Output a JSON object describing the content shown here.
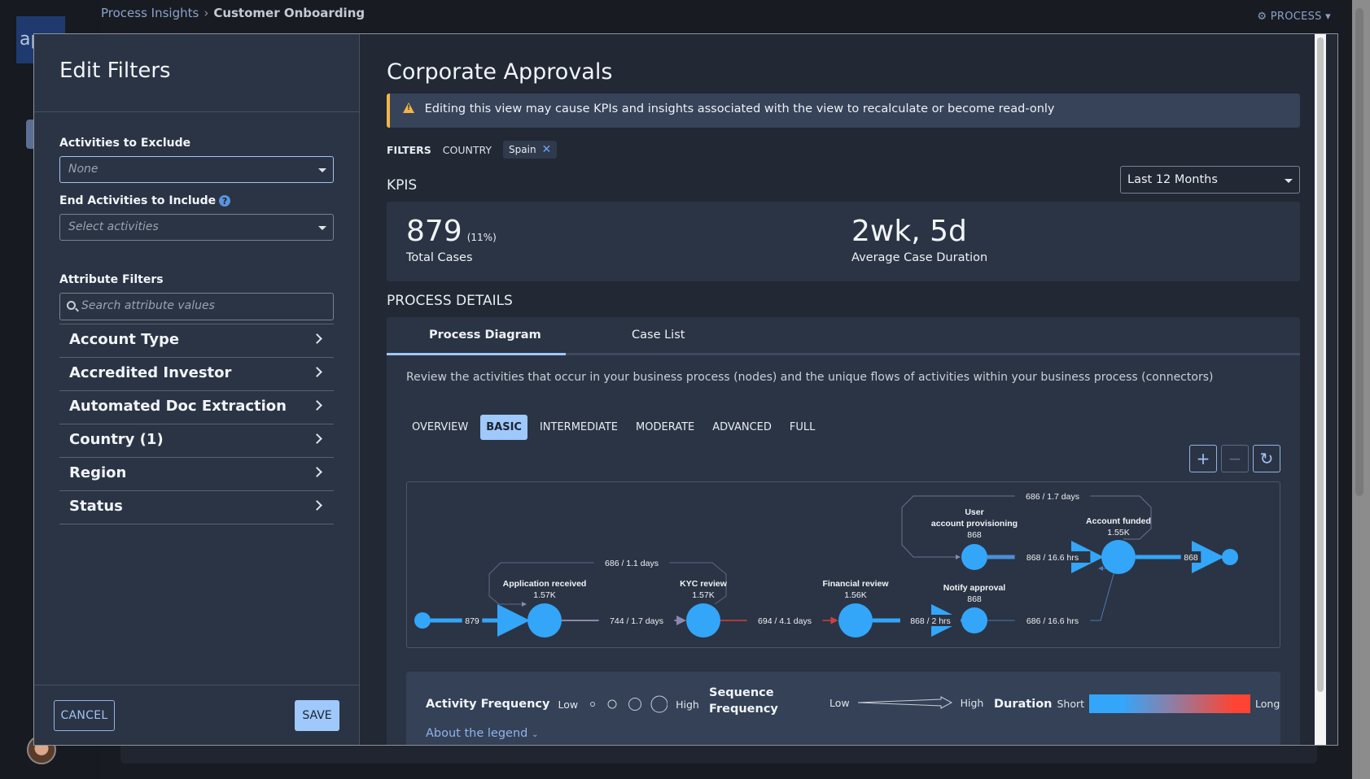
{
  "app": {
    "logo_text": "ap",
    "breadcrumb": {
      "parent": "Process Insights",
      "separator": "›",
      "current": "Customer Onboarding"
    },
    "process_menu": {
      "label": "PROCESS",
      "icon": "gear-icon"
    }
  },
  "filters_panel": {
    "title": "Edit Filters",
    "activities_to_exclude": {
      "label": "Activities to Exclude",
      "value": "None"
    },
    "end_activities": {
      "label": "End Activities to Include",
      "placeholder": "Select activities",
      "help_icon": "question-circle-icon"
    },
    "attribute_filters": {
      "label": "Attribute Filters",
      "search_placeholder": "Search attribute values",
      "items": [
        {
          "label": "Account Type"
        },
        {
          "label": "Accredited Investor"
        },
        {
          "label": "Automated Doc Extraction"
        },
        {
          "label": "Country (1)"
        },
        {
          "label": "Region"
        },
        {
          "label": "Status"
        }
      ]
    },
    "cancel_label": "CANCEL",
    "save_label": "SAVE"
  },
  "view": {
    "title": "Corporate Approvals",
    "warning": "Editing this view may cause KPIs and insights associated with the view to recalculate or become read-only",
    "filters": {
      "label": "FILTERS",
      "key": "COUNTRY",
      "chip": "Spain"
    },
    "kpis_title": "KPIS",
    "period": "Last 12 Months",
    "kpis": [
      {
        "value": "879",
        "pct": "(11%)",
        "caption": "Total Cases"
      },
      {
        "value": "2wk, 5d",
        "caption": "Average Case Duration"
      }
    ],
    "process_details_title": "PROCESS DETAILS",
    "tabs": [
      {
        "label": "Process Diagram",
        "active": true
      },
      {
        "label": "Case List",
        "active": false
      }
    ],
    "description": "Review the activities that occur in your business process (nodes) and the unique flows of activities within your business process (connectors)",
    "levels": [
      {
        "label": "OVERVIEW",
        "active": false
      },
      {
        "label": "BASIC",
        "active": true
      },
      {
        "label": "INTERMEDIATE",
        "active": false
      },
      {
        "label": "MODERATE",
        "active": false
      },
      {
        "label": "ADVANCED",
        "active": false
      },
      {
        "label": "FULL",
        "active": false
      }
    ],
    "zoom": {
      "in": "+",
      "out": "−",
      "reset": "↻"
    }
  },
  "diagram": {
    "nodes": [
      {
        "id": "start",
        "label": "",
        "count": ""
      },
      {
        "id": "app",
        "label": "Application received",
        "count": "1.57K"
      },
      {
        "id": "kyc",
        "label": "KYC review",
        "count": "1.57K"
      },
      {
        "id": "fin",
        "label": "Financial review",
        "count": "1.56K"
      },
      {
        "id": "notify",
        "label": "Notify approval",
        "count": "868"
      },
      {
        "id": "user",
        "label": "User account provisioning",
        "label_lines": [
          "User",
          "account provisioning"
        ],
        "count": "868"
      },
      {
        "id": "funded",
        "label": "Account funded",
        "count": "1.55K"
      },
      {
        "id": "end",
        "label": "",
        "count": ""
      }
    ],
    "edges": [
      {
        "from": "start",
        "to": "app",
        "label": "879",
        "duration": "short"
      },
      {
        "from": "app",
        "to": "kyc",
        "label": "744 / 1.7 days",
        "duration": "medium"
      },
      {
        "from": "kyc",
        "to": "app",
        "label": "686 / 1.1 days",
        "duration": "short"
      },
      {
        "from": "kyc",
        "to": "fin",
        "label": "694 / 4.1 days",
        "duration": "long"
      },
      {
        "from": "fin",
        "to": "notify",
        "label": "868 / 2 hrs",
        "duration": "short"
      },
      {
        "from": "notify",
        "to": "funded",
        "label": "686 / 16.6 hrs",
        "duration": "short"
      },
      {
        "from": "user",
        "to": "funded",
        "label": "868 / 16.6 hrs",
        "duration": "short"
      },
      {
        "from": "funded",
        "to": "user",
        "label": "686 / 1.7 days",
        "duration": "medium"
      },
      {
        "from": "funded",
        "to": "end",
        "label": "868",
        "duration": "short"
      }
    ]
  },
  "legend": {
    "activity_frequency": {
      "title": "Activity Frequency",
      "low": "Low",
      "high": "High"
    },
    "sequence_frequency": {
      "title_line1": "Sequence",
      "title_line2": "Frequency",
      "low": "Low",
      "high": "High"
    },
    "duration": {
      "title": "Duration",
      "short": "Short",
      "long": "Long",
      "colors": [
        "#33a6fa",
        "#ff4433"
      ]
    },
    "about_link": "About the legend"
  }
}
